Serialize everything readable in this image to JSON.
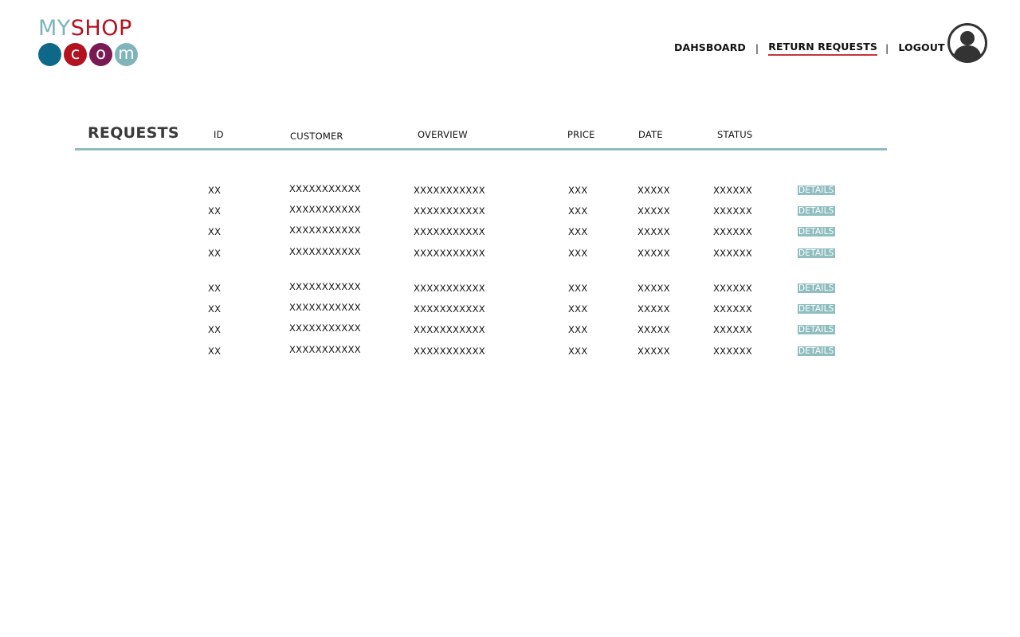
{
  "logo": {
    "word_my": "MY",
    "word_shop": "SHOP",
    "dots": [
      {
        "letter": "",
        "color": "#0e6889"
      },
      {
        "letter": "c",
        "color": "#b3121f"
      },
      {
        "letter": "o",
        "color": "#7a1a52"
      },
      {
        "letter": "m",
        "color": "#7fb4bb"
      }
    ]
  },
  "nav": {
    "dashboard": "DAHSBOARD",
    "return_requests": "RETURN REQUESTS",
    "logout": "LOGOUT",
    "separator": "|",
    "active": "return_requests"
  },
  "user": {
    "icon": "user-avatar-icon"
  },
  "table": {
    "title": "REQUESTS",
    "columns": {
      "id": "ID",
      "customer": "CUSTOMER",
      "overview": "OVERVIEW",
      "price": "PRICE",
      "date": "DATE",
      "status": "STATUS"
    },
    "details_label": "DETAILS",
    "rows": [
      {
        "id": "XX",
        "customer": "XXXXXXXXXXX",
        "overview": "XXXXXXXXXXX",
        "price": "XXX",
        "date": "XXXXX",
        "status": "XXXXXX"
      },
      {
        "id": "XX",
        "customer": "XXXXXXXXXXX",
        "overview": "XXXXXXXXXXX",
        "price": "XXX",
        "date": "XXXXX",
        "status": "XXXXXX"
      },
      {
        "id": "XX",
        "customer": "XXXXXXXXXXX",
        "overview": "XXXXXXXXXXX",
        "price": "XXX",
        "date": "XXXXX",
        "status": "XXXXXX"
      },
      {
        "id": "XX",
        "customer": "XXXXXXXXXXX",
        "overview": "XXXXXXXXXXX",
        "price": "XXX",
        "date": "XXXXX",
        "status": "XXXXXX"
      },
      {
        "id": "XX",
        "customer": "XXXXXXXXXXX",
        "overview": "XXXXXXXXXXX",
        "price": "XXX",
        "date": "XXXXX",
        "status": "XXXXXX"
      },
      {
        "id": "XX",
        "customer": "XXXXXXXXXXX",
        "overview": "XXXXXXXXXXX",
        "price": "XXX",
        "date": "XXXXX",
        "status": "XXXXXX"
      },
      {
        "id": "XX",
        "customer": "XXXXXXXXXXX",
        "overview": "XXXXXXXXXXX",
        "price": "XXX",
        "date": "XXXXX",
        "status": "XXXXXX"
      },
      {
        "id": "XX",
        "customer": "XXXXXXXXXXX",
        "overview": "XXXXXXXXXXX",
        "price": "XXX",
        "date": "XXXXX",
        "status": "XXXXXX"
      }
    ]
  },
  "colors": {
    "accent": "#8fbdc0",
    "nav_underline": "#c7343a"
  }
}
